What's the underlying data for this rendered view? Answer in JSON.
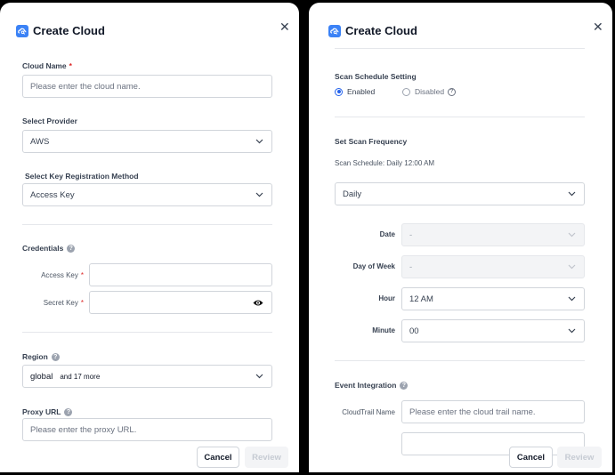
{
  "left_panel": {
    "title": "Create Cloud",
    "close_icon": "✕",
    "cloud_name": {
      "label": "Cloud Name",
      "required": "*",
      "placeholder": "Please enter the cloud name."
    },
    "provider": {
      "label": "Select Provider",
      "value": "AWS"
    },
    "key_method": {
      "label": "Select Key Registration Method",
      "value": "Access Key"
    },
    "credentials": {
      "label": "Credentials",
      "access_key_label": "Access Key",
      "secret_key_label": "Secret Key",
      "required": "*"
    },
    "region": {
      "label": "Region",
      "value": "global",
      "more": "and 17 more"
    },
    "proxy": {
      "label": "Proxy URL",
      "placeholder": "Please enter the proxy URL."
    },
    "cancel": "Cancel",
    "review": "Review"
  },
  "right_panel": {
    "title": "Create Cloud",
    "close_icon": "✕",
    "schedule_setting": {
      "label": "Scan Schedule Setting",
      "enabled": "Enabled",
      "disabled": "Disabled",
      "selected": "Enabled"
    },
    "frequency": {
      "label": "Set Scan Frequency",
      "schedule_text": "Scan Schedule: Daily 12:00 AM",
      "value": "Daily"
    },
    "date": {
      "label": "Date",
      "value": "-"
    },
    "day_of_week": {
      "label": "Day of Week",
      "value": "-"
    },
    "hour": {
      "label": "Hour",
      "value": "12 AM"
    },
    "minute": {
      "label": "Minute",
      "value": "00"
    },
    "event_integration": {
      "label": "Event Integration",
      "cloudtrail_label": "CloudTrail Name",
      "cloudtrail_placeholder": "Please enter the cloud trail name."
    },
    "cancel": "Cancel",
    "review": "Review"
  },
  "colors": {
    "accent": "#3b82f6",
    "radio_selected": "#2563eb",
    "required": "#dc2626"
  },
  "icons": {
    "logo": "cloud-scan-icon",
    "close": "close-icon",
    "chevron": "chevron-down-icon",
    "eye": "eye-icon",
    "help": "help-icon"
  }
}
